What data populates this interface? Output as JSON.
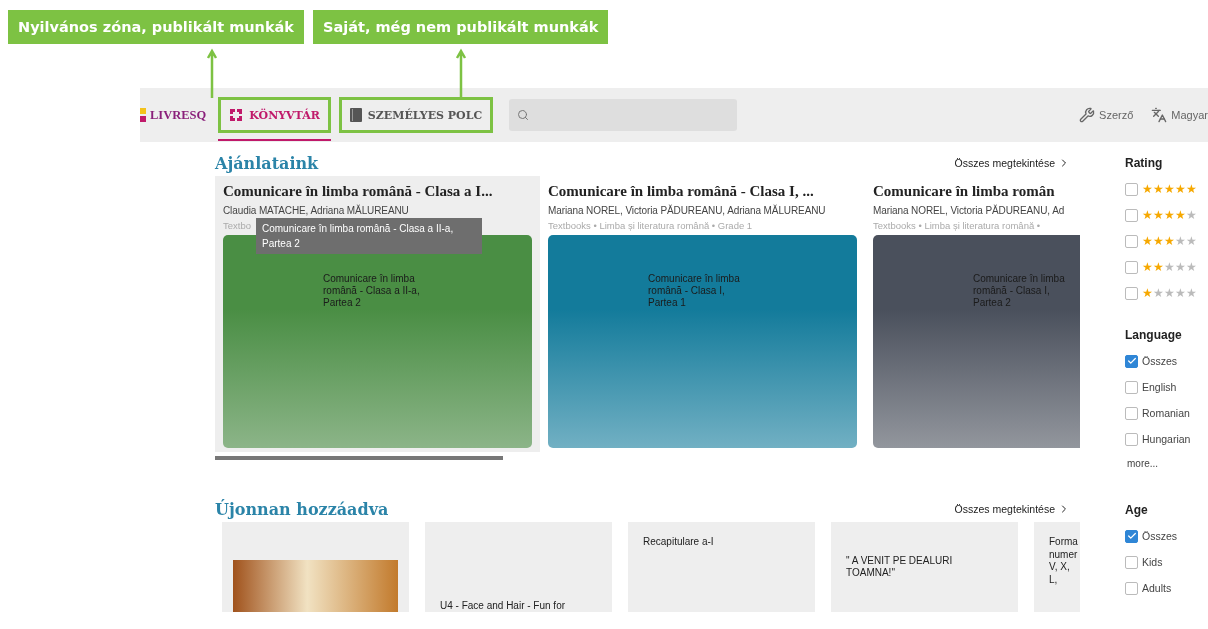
{
  "annotations": [
    {
      "label": "Nyilvános zóna, publikált munkák"
    },
    {
      "label": "Saját, még nem publikált munkák"
    }
  ],
  "header": {
    "logo": "LIVRESQ",
    "tabs": [
      {
        "label": "KÖNYVTÁR",
        "selected": true,
        "highlighted": true
      },
      {
        "label": "SZEMÉLYES POLC",
        "selected": false,
        "highlighted": true
      }
    ],
    "author": "Szerző",
    "language": "Magyar"
  },
  "featured": {
    "title": "Ajánlataink",
    "view_all": "Összes megtekintése",
    "tooltip": "Comunicare în limba română - Clasa a II-a, Partea 2",
    "cards": [
      {
        "title": "Comunicare în limba română - Clasa a I...",
        "authors": "Claudia MATACHE, Adriana MĂLUREANU",
        "meta": "Textbo",
        "cover_text": "Comunicare în limba română - Clasa a II-a, Partea 2",
        "color": "#4a8e44",
        "hovered": true
      },
      {
        "title": "Comunicare în limba română - Clasa I, ...",
        "authors": "Mariana NOREL, Victoria PĂDUREANU, Adriana MĂLUREANU",
        "meta": "Textbooks • Limba și literatura română • Grade 1",
        "cover_text": "Comunicare în limba română - Clasa I, Partea 1",
        "color": "#137b9b",
        "hovered": false
      },
      {
        "title": "Comunicare în limba român",
        "authors": "Mariana NOREL, Victoria PĂDUREANU, Ad",
        "meta": "Textbooks • Limba și literatura română •",
        "cover_text": "Comunicare în limba română - Clasa I, Partea 2",
        "color": "#4a505c",
        "hovered": false
      }
    ]
  },
  "recent": {
    "title": "Újonnan hozzáadva",
    "view_all": "Összes megtekintése",
    "cards": [
      {
        "kind": "photo"
      },
      {
        "kind": "bottom",
        "text": "U4 - Face and Hair - Fun for"
      },
      {
        "kind": "top",
        "text": "Recapitulare a-I"
      },
      {
        "kind": "middle",
        "text": "\" A VENIT PE DEALURI TOAMNA!\""
      },
      {
        "kind": "top",
        "text": "Forma numer V, X, L,"
      }
    ]
  },
  "filters": {
    "rating": {
      "title": "Rating",
      "rows": [
        {
          "checked": false,
          "stars": 5
        },
        {
          "checked": false,
          "stars": 4
        },
        {
          "checked": false,
          "stars": 3
        },
        {
          "checked": false,
          "stars": 2
        },
        {
          "checked": false,
          "stars": 1
        }
      ]
    },
    "language": {
      "title": "Language",
      "options": [
        {
          "label": "Összes",
          "checked": true
        },
        {
          "label": "English",
          "checked": false
        },
        {
          "label": "Romanian",
          "checked": false
        },
        {
          "label": "Hungarian",
          "checked": false
        }
      ],
      "more": "more..."
    },
    "age": {
      "title": "Age",
      "options": [
        {
          "label": "Összes",
          "checked": true
        },
        {
          "label": "Kids",
          "checked": false
        },
        {
          "label": "Adults",
          "checked": false
        }
      ]
    }
  }
}
